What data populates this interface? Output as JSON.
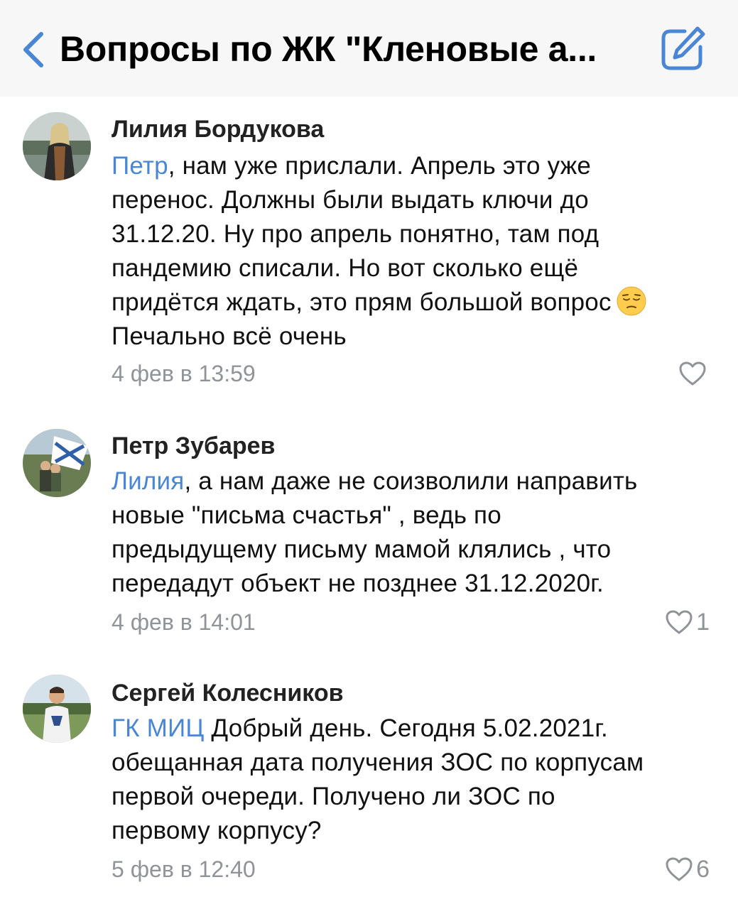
{
  "header": {
    "title": "Вопросы по ЖК \"Кленовые а...",
    "back_icon": "chevron-left-icon",
    "compose_icon": "compose-icon",
    "accent_color": "#4a86d6"
  },
  "comments": [
    {
      "author": "Лилия Бордукова",
      "mention": "Петр",
      "lines": [
        ", нам уже прислали. Апрель это уже",
        "перенос. Должны были выдать ключи до",
        "31.12.20. Ну про апрель понятно, там под",
        "пандемию списали. Но вот сколько ещё",
        "придётся ждать, это прям большой вопрос",
        "Печально всё очень"
      ],
      "emoji": "pensive-face-emoji",
      "timestamp": "4 фев в 13:59",
      "likes": ""
    },
    {
      "author": "Петр Зубарев",
      "mention": "Лилия",
      "lines": [
        ", а нам даже не соизволили направить",
        "новые \"письма счастья\" , ведь по",
        "предыдущему письму мамой клялись , что",
        "передадут объект не позднее 31.12.2020г."
      ],
      "timestamp": "4 фев в 14:01",
      "likes": "1"
    },
    {
      "author": "Сергей Колесников",
      "mention": "ГК МИЦ",
      "lines": [
        " Добрый день. Сегодня 5.02.2021г.",
        "обещанная дата получения ЗОС по корпусам",
        "первой очереди. Получено ли ЗОС по",
        "первому корпусу?"
      ],
      "timestamp": "5 фев в 12:40",
      "likes": "6"
    }
  ]
}
